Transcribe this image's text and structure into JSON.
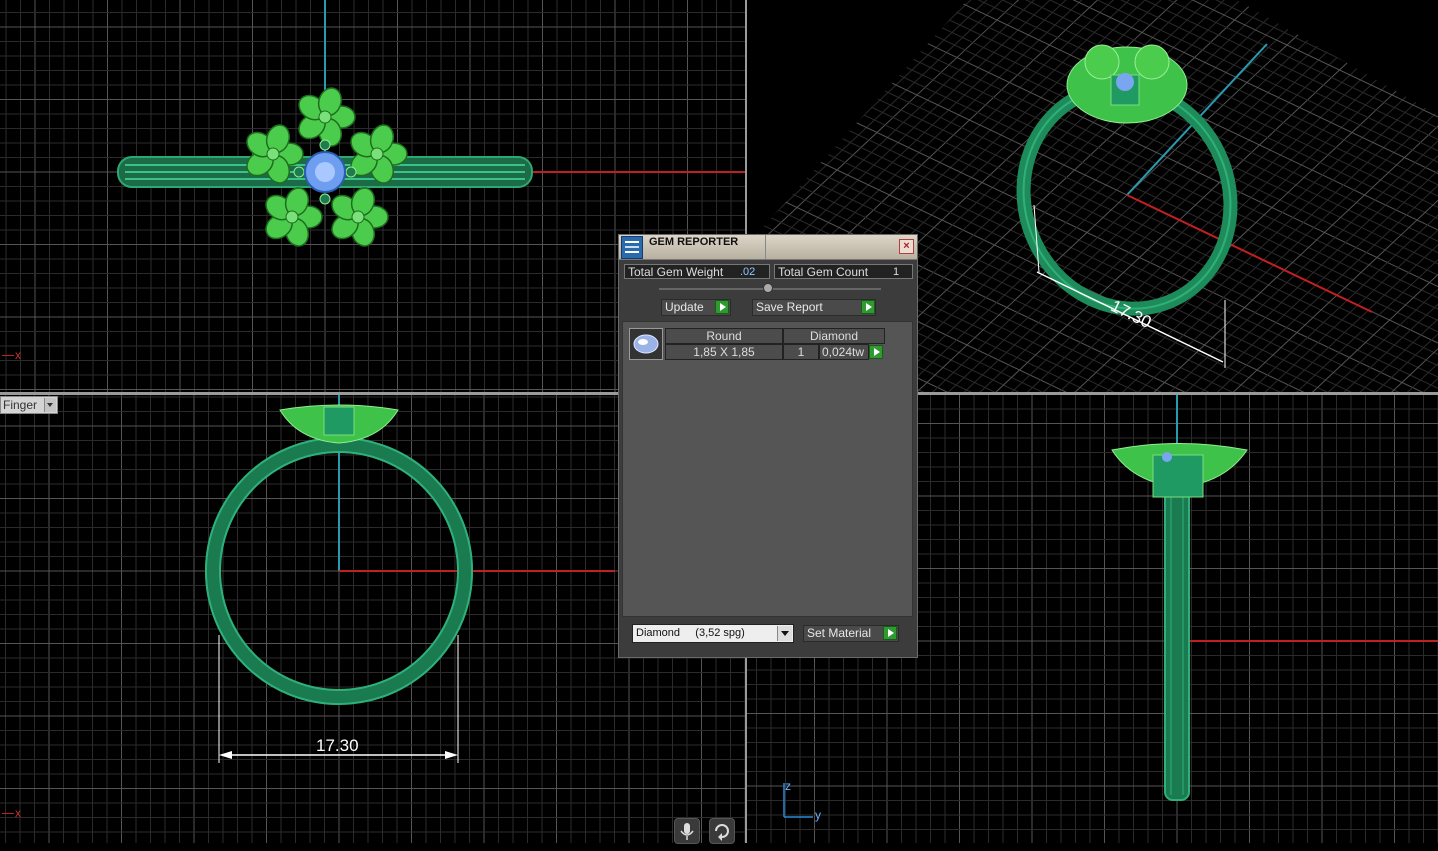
{
  "dialog": {
    "title": "GEM REPORTER",
    "close_glyph": "×",
    "total_weight_label": "Total Gem Weight",
    "total_weight_value": ".02",
    "total_count_label": "Total Gem Count",
    "total_count_value": "1",
    "update_label": "Update",
    "save_report_label": "Save Report",
    "gems": [
      {
        "shape": "Round",
        "material": "Diamond",
        "size": "1,85 X 1,85",
        "count": "1",
        "weight": "0,024tw"
      }
    ],
    "material_select": "Diamond     (3,52 spg)",
    "set_material_label": "Set Material"
  },
  "viewports": {
    "top_left_axis": "x",
    "bottom_left_axis": "x",
    "front_dimension": "17.30",
    "perspective_dimension": "17.30",
    "finger_dropdown": "Finger",
    "triad_z": "z",
    "triad_y": "y"
  },
  "icons": {
    "dialog_icon": "gem-reporter-icon",
    "mic": "microphone-icon",
    "rotate": "rotate-icon"
  },
  "colors": {
    "ring_green": "#1f9a62",
    "flower_green": "#4ccc4c",
    "gem_blue": "#7aa6f0",
    "axis_red": "#c02020",
    "axis_cyan": "#2a9ab0"
  }
}
